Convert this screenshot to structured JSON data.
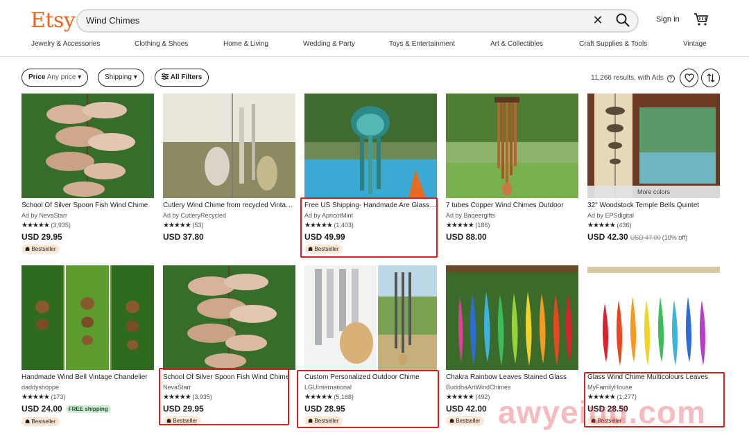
{
  "header": {
    "logo": "Etsy",
    "search_value": "Wind Chimes",
    "sign_in": "Sign in"
  },
  "nav": [
    "Jewelry & Accessories",
    "Clothing & Shoes",
    "Home & Living",
    "Wedding & Party",
    "Toys & Entertainment",
    "Art & Collectibles",
    "Craft Supplies & Tools",
    "Vintage"
  ],
  "filters": {
    "price_label": "Price",
    "price_value": "Any price",
    "shipping": "Shipping",
    "all_filters": "All Filters",
    "results": "11,266 results, with Ads"
  },
  "listings": [
    {
      "title": "School Of Silver Spoon Fish Wind Chime",
      "shop": "Ad by NevaStarr",
      "reviews": "(3,935)",
      "price": "USD 29.95",
      "badge": "Bestseller"
    },
    {
      "title": "Cutlery Wind Chime from recycled Vintage Silverware",
      "shop": "Ad by CutleryRecycled",
      "reviews": "(53)",
      "price": "USD 37.80"
    },
    {
      "title": "Free US Shipping- Handmade Are Glass Jellyfish",
      "shop": "Ad by ApricotMint",
      "reviews": "(1,403)",
      "price": "USD 49.99",
      "badge": "Bestseller"
    },
    {
      "title": "7 tubes Copper Wind Chimes Outdoor",
      "shop": "Ad by Baqeergifts",
      "reviews": "(186)",
      "price": "USD 88.00"
    },
    {
      "title": "32\" Woodstock Temple Bells Quintet",
      "shop": "Ad by EPSdigital",
      "reviews": "(436)",
      "price": "USD 42.30",
      "old_price": "USD 47.00",
      "discount": "(10% off)",
      "overlay": "More colors"
    },
    {
      "title": "Handmade Wind Bell Vintage Chandelier",
      "shop": "daddyshoppe",
      "reviews": "(173)",
      "price": "USD 24.00",
      "free_shipping": "FREE shipping",
      "badge": "Bestseller"
    },
    {
      "title": "School Of Silver Spoon Fish Wind Chime",
      "shop": "NevaStarr",
      "reviews": "(3,935)",
      "price": "USD 29.95",
      "badge": "Bestseller"
    },
    {
      "title": "Custom Personalized Outdoor Chime",
      "shop": "LGUInternational",
      "reviews": "(5,168)",
      "price": "USD 28.95",
      "badge": "Bestseller"
    },
    {
      "title": "Chakra Rainbow Leaves Stained Glass",
      "shop": "BuddhaArtWindChimes",
      "reviews": "(492)",
      "price": "USD 42.00",
      "badge": "Bestseller"
    },
    {
      "title": "Glass Wind Chime Multicolours Leaves",
      "shop": "MyFamilyHouse",
      "reviews": "(1,277)",
      "price": "USD 28.50",
      "badge": "Bestseller"
    }
  ],
  "stars": "★★★★★",
  "watermark": "awyeiuu.com",
  "colors": {
    "brand": "#f1641e",
    "highlight": "#d42020"
  }
}
